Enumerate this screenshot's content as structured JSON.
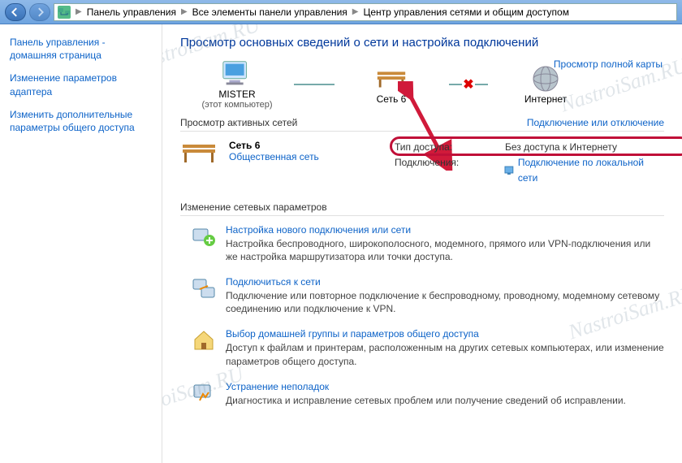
{
  "breadcrumbs": {
    "b1": "Панель управления",
    "b2": "Все элементы панели управления",
    "b3": "Центр управления сетями и общим доступом"
  },
  "sidebar": {
    "home": "Панель управления - домашняя страница",
    "adapter": "Изменение параметров адаптера",
    "sharing": "Изменить дополнительные параметры общего доступа"
  },
  "main": {
    "title": "Просмотр основных сведений о сети и настройка подключений",
    "map_link": "Просмотр полной карты",
    "nodes": {
      "pc_name": "MISTER",
      "pc_sub": "(этот компьютер)",
      "net_name": "Сеть 6",
      "internet": "Интернет"
    },
    "active_section": "Просмотр активных сетей",
    "connect_link": "Подключение или отключение",
    "active_net": {
      "name": "Сеть 6",
      "type": "Общественная сеть",
      "access_label": "Тип доступа:",
      "access_value": "Без доступа к Интернету",
      "conn_label": "Подключения:",
      "conn_value": "Подключение по локальной сети"
    },
    "params_title": "Изменение сетевых параметров",
    "tasks": [
      {
        "link": "Настройка нового подключения или сети",
        "desc": "Настройка беспроводного, широкополосного, модемного, прямого или VPN-подключения или же настройка маршрутизатора или точки доступа."
      },
      {
        "link": "Подключиться к сети",
        "desc": "Подключение или повторное подключение к беспроводному, проводному, модемному сетевому соединению или подключение к VPN."
      },
      {
        "link": "Выбор домашней группы и параметров общего доступа",
        "desc": "Доступ к файлам и принтерам, расположенным на других сетевых компьютерах, или изменение параметров общего доступа."
      },
      {
        "link": "Устранение неполадок",
        "desc": "Диагностика и исправление сетевых проблем или получение сведений об исправлении."
      }
    ]
  },
  "watermark": "NastroiSam.RU"
}
